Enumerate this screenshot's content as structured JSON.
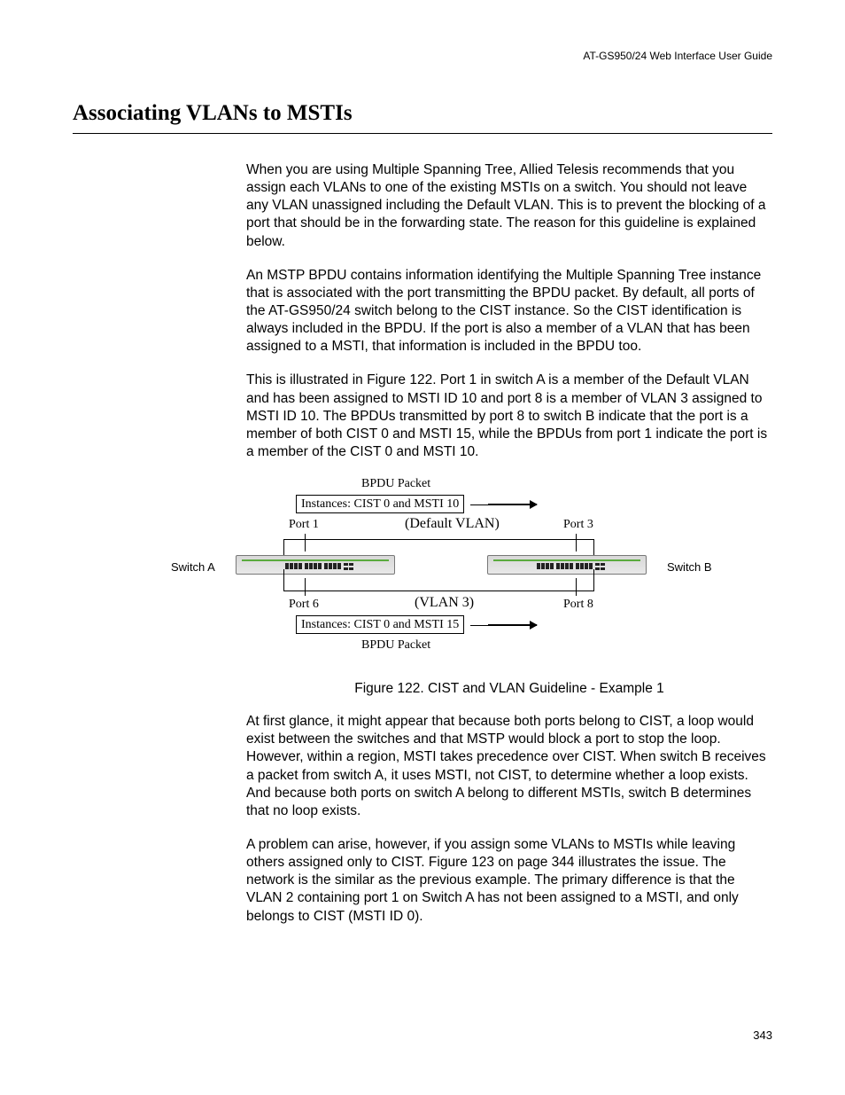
{
  "header": "AT-GS950/24  Web Interface User Guide",
  "title": "Associating VLANs to MSTIs",
  "p1": "When you are using Multiple Spanning Tree, Allied Telesis recommends that you assign each VLANs to one of the existing MSTIs on a switch. You should not leave any VLAN unassigned including the Default VLAN. This is to prevent the blocking of a port that should be in the forwarding state. The reason for this guideline is explained below.",
  "p2": "An MSTP BPDU contains information identifying the Multiple Spanning Tree instance that is associated with the port transmitting the BPDU packet. By default, all ports of the AT-GS950/24 switch belong to the CIST instance. So the CIST identification is always included in the BPDU. If the port is also a member of a VLAN that has been assigned to a MSTI, that information is included in the BPDU too.",
  "p3": "This is illustrated in Figure 122. Port 1 in switch A is a member of the Default VLAN and has been assigned to MSTI ID 10 and port 8 is a member of VLAN 3 assigned to MSTI ID 10. The BPDUs transmitted by port 8 to switch B indicate that the port is a member of both CIST 0 and MSTI 15, while the BPDUs from port 1 indicate the port is a member of the CIST 0 and MSTI 10.",
  "figcaption": "Figure 122. CIST and VLAN Guideline - Example 1",
  "p4": "At first glance, it might appear that because both ports belong to CIST, a loop would exist between the switches and that MSTP would block a port to stop the loop. However, within a region, MSTI takes precedence over CIST. When switch B receives a packet from switch A, it uses MSTI, not CIST, to determine whether a loop exists. And because both ports on switch A belong to different MSTIs, switch B determines that no loop exists.",
  "p5": "A problem can arise, however, if you assign some VLANs to MSTIs while leaving others assigned only to CIST. Figure 123 on page 344 illustrates the issue. The network is the similar as the previous example. The primary difference is that the VLAN 2 containing port 1 on Switch A has not been assigned to a MSTI, and only belongs to CIST (MSTI ID 0).",
  "pagenum": "343",
  "diagram": {
    "bpdu_top": "BPDU Packet",
    "inst_top": "Instances: CIST 0 and MSTI 10",
    "default_vlan": "(Default VLAN)",
    "port1": "Port 1",
    "port3": "Port 3",
    "switch_a": "Switch A",
    "switch_b": "Switch B",
    "port6": "Port 6",
    "port8": "Port 8",
    "vlan3": "(VLAN 3)",
    "inst_bot": "Instances: CIST 0 and MSTI 15",
    "bpdu_bot": "BPDU Packet"
  }
}
